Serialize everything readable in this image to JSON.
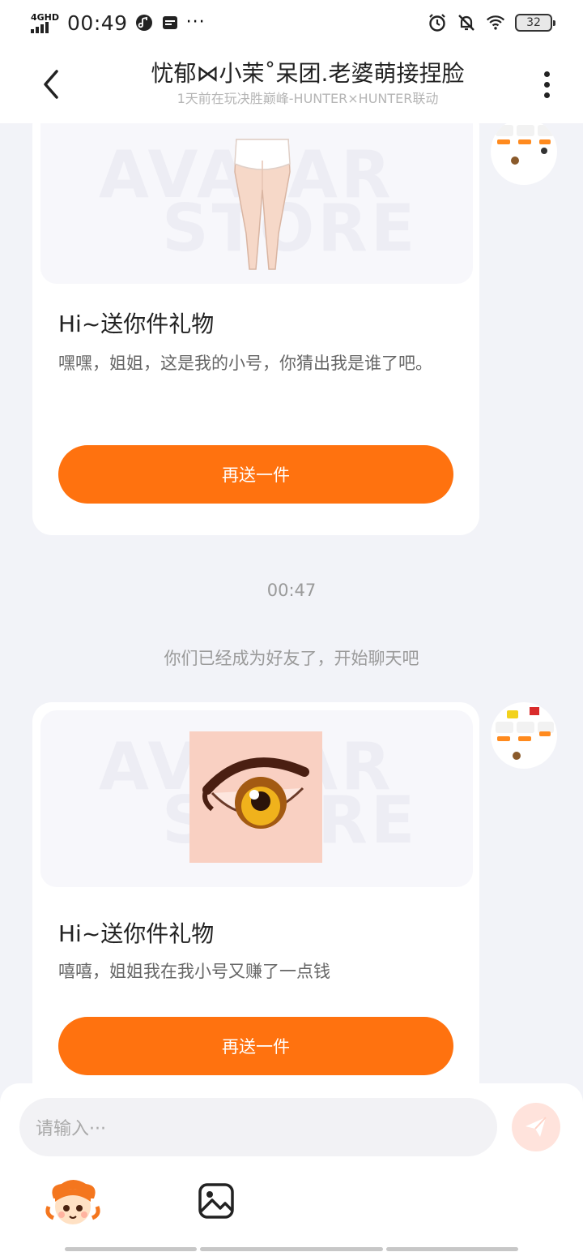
{
  "status_bar": {
    "network": "4GHD",
    "time": "00:49",
    "battery": "32",
    "icons": [
      "music-app-icon",
      "sim-card-icon",
      "more-dots-icon",
      "alarm-icon",
      "mute-icon",
      "wifi-icon",
      "battery-icon"
    ],
    "more": "···"
  },
  "header": {
    "title": "忧郁⋈小茉˚呆团.老婆萌接捏脸",
    "subtitle": "1天前在玩决胜巅峰-HUNTER×HUNTER联动",
    "icons": [
      "back-arrow-icon",
      "more-vertical-icon"
    ]
  },
  "chat": {
    "watermark_line1": "AVATAR",
    "watermark_line2": "STORE",
    "messages": [
      {
        "gift_item": "leggings",
        "title": "Hi~送你件礼物",
        "text": "嘿嘿，姐姐，这是我的小号，你猜出我是谁了吧。",
        "button": "再送一件"
      },
      {
        "gift_item": "anime-eye",
        "title": "Hi~送你件礼物",
        "text": "嘻嘻，姐姐我在我小号又赚了一点钱",
        "button": "再送一件"
      }
    ],
    "timestamp": "00:47",
    "system_message": "你们已经成为好友了，开始聊天吧"
  },
  "input": {
    "placeholder": "请输入···",
    "icons": [
      "send-icon",
      "mascot-emoji-icon",
      "image-icon"
    ]
  },
  "colors": {
    "accent": "#ff720f",
    "background": "#f2f3f8",
    "send_button": "#ffe3dc"
  }
}
